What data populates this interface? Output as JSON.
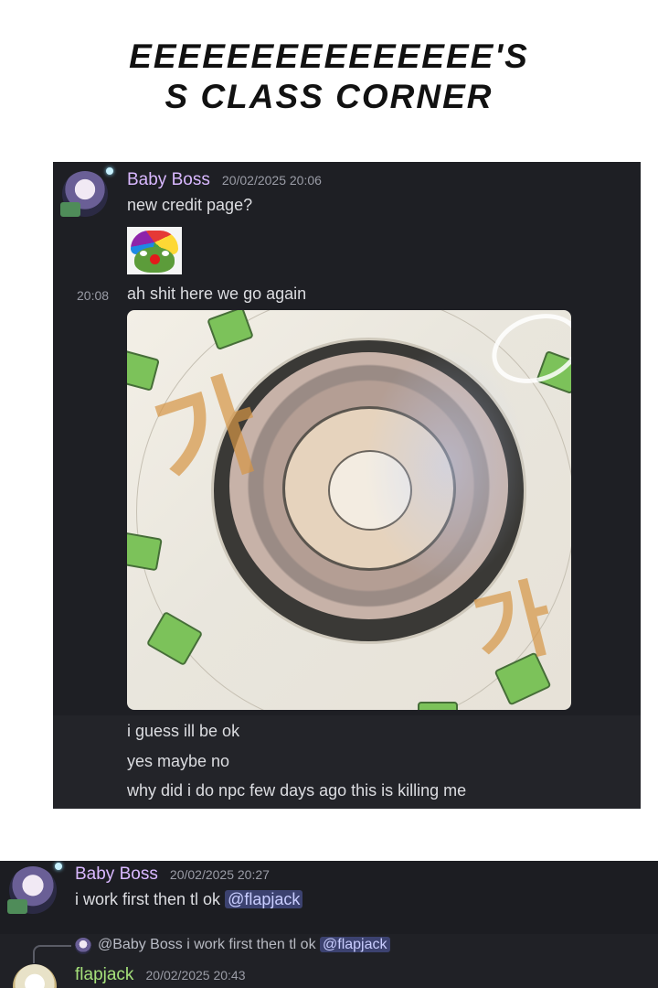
{
  "page": {
    "title_line1": "EEEEEEEEEEEEEEE'S",
    "title_line2": "S CLASS CORNER"
  },
  "chat1": {
    "author": "Baby Boss",
    "timestamp": "20/02/2025 20:06",
    "messages": [
      "new credit page?",
      "ah shit here we go again",
      "i guess ill be ok",
      "yes maybe no",
      "why did i do npc few days ago this is killing me"
    ],
    "side_time": "20:08",
    "emoji": "clown-pepe",
    "image_text": {
      "left_glyph": "가",
      "right_glyph": "가"
    }
  },
  "chat2": {
    "author": "Baby Boss",
    "timestamp": "20/02/2025 20:27",
    "message": "i work first then tl ok",
    "mention": "@flapjack",
    "reply": {
      "author": "@Baby Boss",
      "text": "i work first then tl ok",
      "mention": "@flapjack"
    },
    "second_author": "flapjack",
    "second_timestamp": "20/02/2025 20:43"
  },
  "colors": {
    "username": "#d9b8ff",
    "username_flapjack": "#a5e07a",
    "chat_bg": "#1e1f24",
    "mention_bg": "#3c4270"
  }
}
